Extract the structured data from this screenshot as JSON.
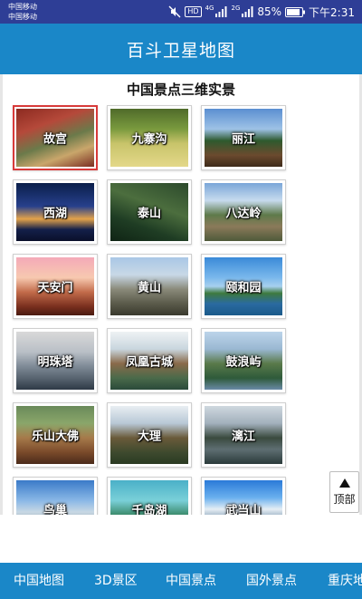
{
  "status_bar": {
    "carrier_1": "中国移动",
    "carrier_2": "中国移动",
    "hd": "HD",
    "net_1": "4G",
    "net_2": "2G",
    "battery": "85%",
    "time": "下午2:31"
  },
  "app": {
    "title": "百斗卫星地图"
  },
  "section": {
    "title": "中国景点三维实景"
  },
  "tiles": [
    {
      "label": "故宫",
      "active": true
    },
    {
      "label": "九寨沟"
    },
    {
      "label": "丽江"
    },
    {
      "label": "西湖"
    },
    {
      "label": "泰山"
    },
    {
      "label": "八达岭"
    },
    {
      "label": "天安门"
    },
    {
      "label": "黄山"
    },
    {
      "label": "颐和园"
    },
    {
      "label": "明珠塔"
    },
    {
      "label": "凤凰古城"
    },
    {
      "label": "鼓浪屿"
    },
    {
      "label": "乐山大佛"
    },
    {
      "label": "大理"
    },
    {
      "label": "漓江"
    },
    {
      "label": "鸟巢"
    },
    {
      "label": "千岛湖"
    },
    {
      "label": "武当山"
    }
  ],
  "top_button": {
    "label": "顶部"
  },
  "bottom_nav": [
    {
      "label": "中国地图"
    },
    {
      "label": "3D景区"
    },
    {
      "label": "中国景点"
    },
    {
      "label": "国外景点"
    },
    {
      "label": "重庆地"
    }
  ]
}
